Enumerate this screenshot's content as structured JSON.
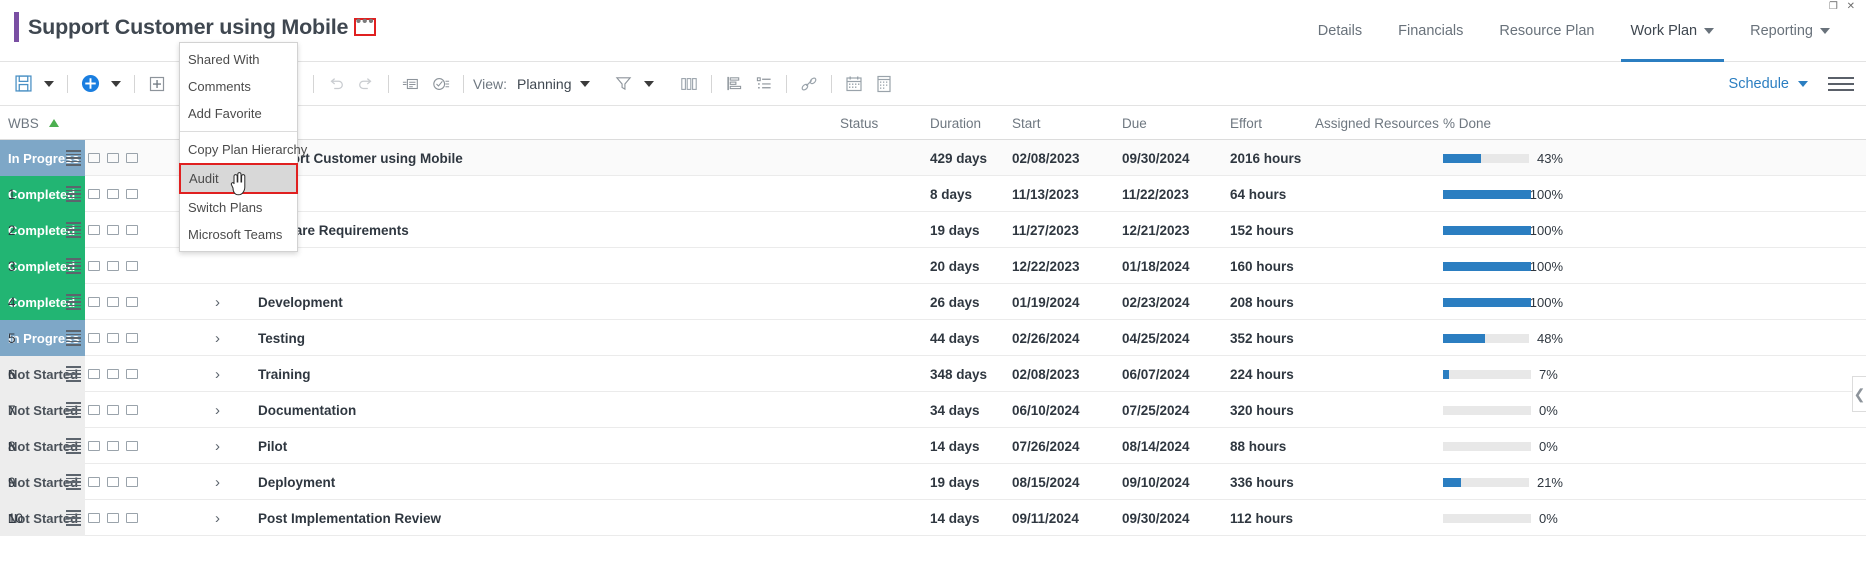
{
  "window": {
    "controls": "❐ ✕"
  },
  "header": {
    "title": "Support Customer using Mobile",
    "ellipsis_label": "•••",
    "nav": [
      {
        "label": "Details",
        "caret": false,
        "active": false
      },
      {
        "label": "Financials",
        "caret": false,
        "active": false
      },
      {
        "label": "Resource Plan",
        "caret": false,
        "active": false
      },
      {
        "label": "Work Plan",
        "caret": true,
        "active": true
      },
      {
        "label": "Reporting",
        "caret": true,
        "active": false
      }
    ]
  },
  "context_menu": {
    "items": [
      {
        "label": "Shared With",
        "highlight": false
      },
      {
        "label": "Comments",
        "highlight": false
      },
      {
        "label": "Add Favorite",
        "highlight": false
      },
      {
        "separator": true
      },
      {
        "label": "Copy Plan Hierarchy",
        "highlight": false
      },
      {
        "label": "Audit",
        "highlight": true
      },
      {
        "label": "Switch Plans",
        "highlight": false
      },
      {
        "label": "Microsoft Teams",
        "highlight": false
      }
    ]
  },
  "toolbar": {
    "save_icon": "save-icon",
    "add_icon": "add-circle-icon",
    "expand_icon": "expand-all-icon",
    "collapse_icon": "collapse-all-icon",
    "indent_icon": "indent-icon",
    "outdent_icon": "outdent-icon",
    "unlink_icon": "unlink-icon",
    "undo_icon": "undo-icon",
    "redo_icon": "redo-icon",
    "assign_icon": "assign-resource-icon",
    "approve_icon": "approve-icon",
    "view_label": "View:",
    "view_value": "Planning",
    "filter_icon": "filter-funnel-icon",
    "columns_icon": "columns-icon",
    "align_icon": "align-icon",
    "outline_icon": "outline-icon",
    "link_icon": "link-icon",
    "calendar_icon": "calendar-icon",
    "notes_icon": "notes-icon",
    "schedule_value": "Schedule",
    "menu_icon": "hamburger-menu-icon"
  },
  "grid": {
    "columns": [
      {
        "key": "wbs",
        "label": "WBS",
        "sorted": true
      },
      {
        "key": "name",
        "label": "",
        "sorted": false
      },
      {
        "key": "status",
        "label": "Status",
        "sorted": false
      },
      {
        "key": "duration",
        "label": "Duration",
        "sorted": false
      },
      {
        "key": "start",
        "label": "Start",
        "sorted": false
      },
      {
        "key": "due",
        "label": "Due",
        "sorted": false
      },
      {
        "key": "effort",
        "label": "Effort",
        "sorted": false
      },
      {
        "key": "resources",
        "label": "Assigned Resources",
        "sorted": false
      },
      {
        "key": "done",
        "label": "% Done",
        "sorted": false
      }
    ],
    "rows": [
      {
        "wbs": "",
        "name": "Support Customer using Mobile",
        "summary": true,
        "chevron": false,
        "status": "In Progress",
        "status_class": "st-inprogress",
        "duration": "429 days",
        "start": "02/08/2023",
        "due": "09/30/2024",
        "effort": "2016 hours",
        "resources": "",
        "pct": "43%",
        "pct_value": 43
      },
      {
        "wbs": "1",
        "name": "",
        "summary": false,
        "chevron": false,
        "status": "Completed",
        "status_class": "st-completed",
        "duration": "8 days",
        "start": "11/13/2023",
        "due": "11/22/2023",
        "effort": "64 hours",
        "resources": "",
        "pct": "100%",
        "pct_value": 100
      },
      {
        "wbs": "2",
        "name": "Software Requirements",
        "summary": false,
        "chevron": false,
        "status": "Completed",
        "status_class": "st-completed",
        "duration": "19 days",
        "start": "11/27/2023",
        "due": "12/21/2023",
        "effort": "152 hours",
        "resources": "",
        "pct": "100%",
        "pct_value": 100
      },
      {
        "wbs": "3",
        "name": "",
        "summary": false,
        "chevron": false,
        "status": "Completed",
        "status_class": "st-completed",
        "duration": "20 days",
        "start": "12/22/2023",
        "due": "01/18/2024",
        "effort": "160 hours",
        "resources": "",
        "pct": "100%",
        "pct_value": 100
      },
      {
        "wbs": "4",
        "name": "Development",
        "summary": false,
        "chevron": true,
        "status": "Completed",
        "status_class": "st-completed",
        "duration": "26 days",
        "start": "01/19/2024",
        "due": "02/23/2024",
        "effort": "208 hours",
        "resources": "",
        "pct": "100%",
        "pct_value": 100
      },
      {
        "wbs": "5",
        "name": "Testing",
        "summary": false,
        "chevron": true,
        "status": "In Progress",
        "status_class": "st-inprogress",
        "duration": "44 days",
        "start": "02/26/2024",
        "due": "04/25/2024",
        "effort": "352 hours",
        "resources": "",
        "pct": "48%",
        "pct_value": 48
      },
      {
        "wbs": "6",
        "name": "Training",
        "summary": false,
        "chevron": true,
        "status": "Not Started",
        "status_class": "st-notstarted",
        "duration": "348 days",
        "start": "02/08/2023",
        "due": "06/07/2024",
        "effort": "224 hours",
        "resources": "",
        "pct": "7%",
        "pct_value": 7
      },
      {
        "wbs": "7",
        "name": "Documentation",
        "summary": false,
        "chevron": true,
        "status": "Not Started",
        "status_class": "st-notstarted",
        "duration": "34 days",
        "start": "06/10/2024",
        "due": "07/25/2024",
        "effort": "320 hours",
        "resources": "",
        "pct": "0%",
        "pct_value": 0
      },
      {
        "wbs": "8",
        "name": "Pilot",
        "summary": false,
        "chevron": true,
        "status": "Not Started",
        "status_class": "st-notstarted",
        "duration": "14 days",
        "start": "07/26/2024",
        "due": "08/14/2024",
        "effort": "88 hours",
        "resources": "",
        "pct": "0%",
        "pct_value": 0
      },
      {
        "wbs": "9",
        "name": "Deployment",
        "summary": false,
        "chevron": true,
        "status": "Not Started",
        "status_class": "st-notstarted",
        "duration": "19 days",
        "start": "08/15/2024",
        "due": "09/10/2024",
        "effort": "336 hours",
        "resources": "",
        "pct": "21%",
        "pct_value": 21
      },
      {
        "wbs": "10",
        "name": "Post Implementation Review",
        "summary": false,
        "chevron": true,
        "status": "Not Started",
        "status_class": "st-notstarted",
        "duration": "14 days",
        "start": "09/11/2024",
        "due": "09/30/2024",
        "effort": "112 hours",
        "resources": "",
        "pct": "0%",
        "pct_value": 0
      }
    ],
    "collapse_handle_icon": "chevron-left-icon"
  },
  "colors": {
    "accent_purple": "#7a4fa3",
    "link_blue": "#2b7ec1",
    "status_inprogress": "#7ea7c7",
    "status_completed": "#22b573",
    "status_notstarted": "#ededed",
    "highlight_red": "#e02020"
  }
}
